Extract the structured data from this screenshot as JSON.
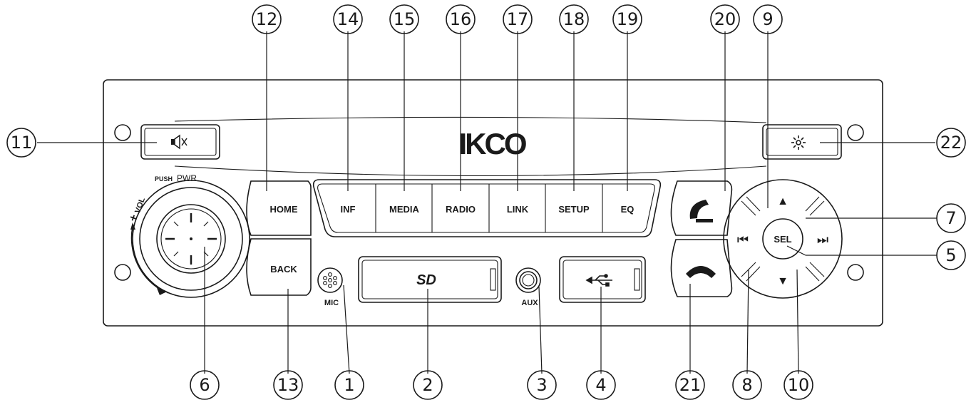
{
  "brand": {
    "logo_text": "IKCO"
  },
  "knob": {
    "push_label": "PUSH",
    "pwr_label": "PWR",
    "vol_plus": "+",
    "vol_label": "VOL",
    "vol_minus": "–"
  },
  "buttons": {
    "home": "HOME",
    "back": "BACK",
    "inf": "INF",
    "media": "MEDIA",
    "radio": "RADIO",
    "link": "LINK",
    "setup": "SETUP",
    "eq": "EQ",
    "sel": "SEL",
    "mute_icon": "mute-speaker-icon",
    "brightness_icon": "brightness-icon",
    "call_answer_icon": "phone-answer-icon",
    "call_end_icon": "phone-hangup-icon",
    "up_glyph": "▲",
    "down_glyph": "▼",
    "prev_glyph": "⏮",
    "next_glyph": "⏭"
  },
  "ports": {
    "mic": "MIC",
    "aux": "AUX",
    "sd_logo": "SD",
    "usb_icon": "usb-icon"
  },
  "callouts": {
    "c1": "1",
    "c2": "2",
    "c3": "3",
    "c4": "4",
    "c5": "5",
    "c6": "6",
    "c7": "7",
    "c8": "8",
    "c9": "9",
    "c10": "10",
    "c11": "11",
    "c12": "12",
    "c13": "13",
    "c14": "14",
    "c15": "15",
    "c16": "16",
    "c17": "17",
    "c18": "18",
    "c19": "19",
    "c20": "20",
    "c21": "21",
    "c22": "22"
  }
}
